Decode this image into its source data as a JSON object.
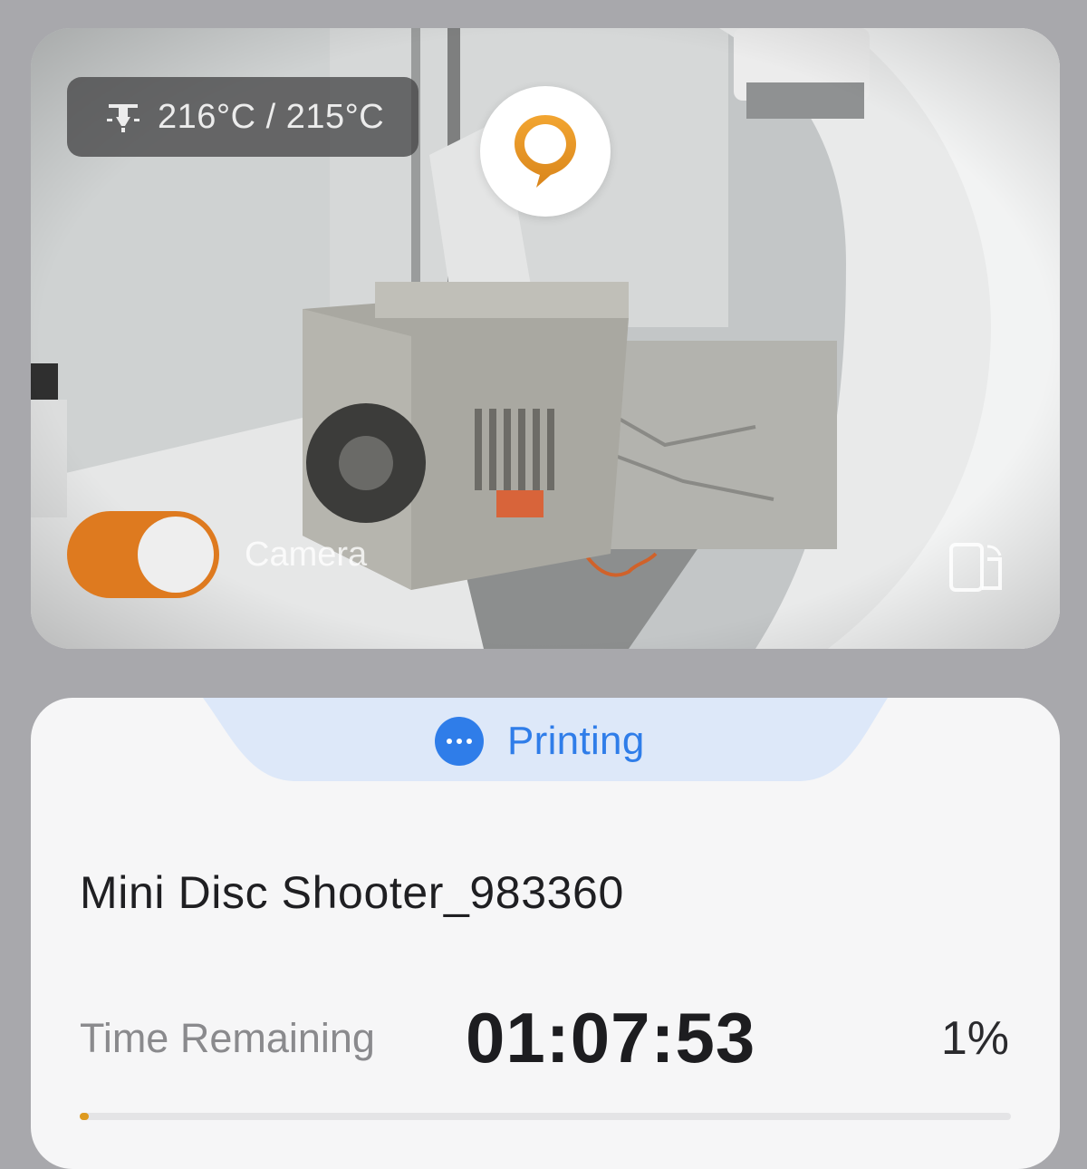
{
  "camera": {
    "temperature_text": "216°C / 215°C",
    "toggle_label": "Camera",
    "toggle_on": true,
    "icons": {
      "temperature": "nozzle-icon",
      "locate": "location-pin-icon",
      "rotate": "rotate-screen-icon"
    }
  },
  "status": {
    "label": "Printing",
    "icon": "more-dots-icon"
  },
  "job": {
    "name": "Mini Disc Shooter_983360",
    "time_remaining_label": "Time Remaining",
    "time_remaining": "01:07:53",
    "progress_text": "1%",
    "progress_value": 0.01
  },
  "colors": {
    "accent_orange": "#de7a1f",
    "status_blue": "#2f7de9",
    "status_tab_bg": "#dde8f9",
    "progress_fill": "#de9a1f"
  }
}
